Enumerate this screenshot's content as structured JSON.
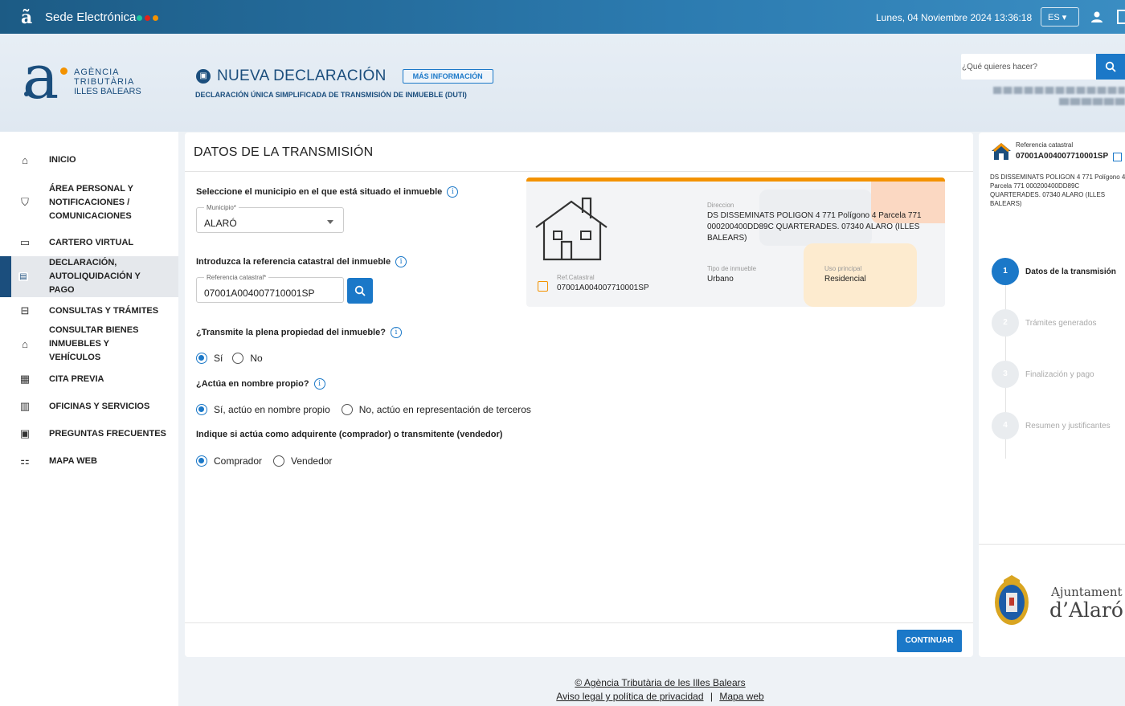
{
  "topbar": {
    "site_title": "Sede Electrónica",
    "datetime": "Lunes, 04 Noviembre 2024 13:36:18",
    "language": "ES ▾",
    "dot_colors": [
      "#1ec6a0",
      "#e2231a",
      "#f39200"
    ]
  },
  "brand": {
    "line1": "AGÈNCIA",
    "line2": "TRIBUTÀRIA",
    "line3": "ILLES BALEARS"
  },
  "page": {
    "title": "NUEVA DECLARACIÓN",
    "more_info": "MÁS INFORMACIÓN",
    "subtitle": "DECLARACIÓN ÚNICA SIMPLIFICADA DE TRANSMISIÓN DE INMUEBLE (DUTI)"
  },
  "search": {
    "placeholder": "¿Qué quieres hacer?"
  },
  "sidebar": {
    "items": [
      {
        "label": "INICIO",
        "icon": "home-icon"
      },
      {
        "label": "ÁREA PERSONAL Y NOTIFICACIONES / COMUNICACIONES",
        "icon": "person-shield-icon"
      },
      {
        "label": "CARTERO VIRTUAL",
        "icon": "laptop-icon"
      },
      {
        "label": "DECLARACIÓN, AUTOLIQUIDACIÓN Y PAGO",
        "icon": "document-icon"
      },
      {
        "label": "CONSULTAS Y TRÁMITES",
        "icon": "briefcase-icon"
      },
      {
        "label": "CONSULTAR BIENES INMUEBLES Y VEHÍCULOS",
        "icon": "house-car-icon"
      },
      {
        "label": "CITA PREVIA",
        "icon": "calendar-clock-icon"
      },
      {
        "label": "OFICINAS Y SERVICIOS",
        "icon": "building-icon"
      },
      {
        "label": "PREGUNTAS FRECUENTES",
        "icon": "faq-icon"
      },
      {
        "label": "MAPA WEB",
        "icon": "sitemap-icon"
      }
    ]
  },
  "form": {
    "title": "DATOS DE LA TRANSMISIÓN",
    "q_municipio": "Seleccione el municipio en el que está situado el inmueble",
    "municipio_label": "Municipio*",
    "municipio_value": "ALARÓ",
    "q_referencia": "Introduzca la referencia catastral del inmueble",
    "referencia_label": "Referencia catastral*",
    "referencia_value": "07001A004007710001SP",
    "q_plena": "¿Transmite la plena propiedad del inmueble?",
    "plena_options": [
      "Sí",
      "No"
    ],
    "plena_selected": "Sí",
    "q_nombre": "¿Actúa en nombre propio?",
    "nombre_options": [
      "Sí, actúo en nombre propio",
      "No, actúo en representación de terceros"
    ],
    "nombre_selected": "Sí, actúo en nombre propio",
    "q_rol": "Indique si actúa como adquirente (comprador) o transmitente (vendedor)",
    "rol_options": [
      "Comprador",
      "Vendedor"
    ],
    "rol_selected": "Comprador",
    "continue_label": "CONTINUAR"
  },
  "property_card": {
    "direccion_label": "Direccion",
    "direccion_value": "DS DISSEMINATS POLIGON 4 771 Polígono 4 Parcela 771 000200400DD89C QUARTERADES. 07340 ALARO (ILLES BALEARS)",
    "ref_label": "Ref.Catastral",
    "ref_value": "07001A004007710001SP",
    "tipo_label": "Tipo de inmueble",
    "tipo_value": "Urbano",
    "uso_label": "Uso principal",
    "uso_value": "Residencial"
  },
  "summary": {
    "ref_label": "Referencia catastral",
    "ref_value": "07001A004007710001SP",
    "address": "DS DISSEMINATS POLIGON 4 771 Polígono 4 Parcela 771 000200400DD89C QUARTERADES. 07340 ALARO (ILLES BALEARS)",
    "steps": [
      {
        "num": "1",
        "label": "Datos de la transmisión",
        "active": true
      },
      {
        "num": "2",
        "label": "Trámites generados",
        "active": false
      },
      {
        "num": "3",
        "label": "Finalización y pago",
        "active": false
      },
      {
        "num": "4",
        "label": "Resumen y justificantes",
        "active": false
      }
    ],
    "ajuntament_line1": "Ajuntament",
    "ajuntament_line2": "d’Alaró"
  },
  "footer": {
    "copyright": "© Agència Tributària de les Illes Balears",
    "legal": "Aviso legal y política de privacidad",
    "separator": "|",
    "sitemap": "Mapa web"
  }
}
